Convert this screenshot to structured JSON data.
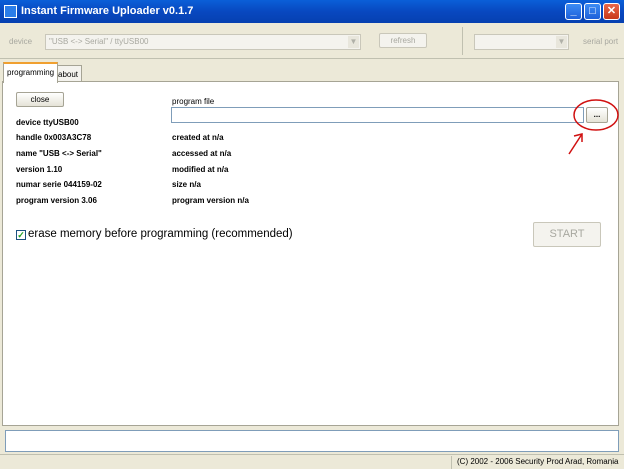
{
  "window": {
    "title": "Instant Firmware Uploader v0.1.7",
    "accent": "#0A5FD8"
  },
  "toolbar": {
    "device_label": "device",
    "device_combo_value": "\"USB <-> Serial\" / ttyUSB00",
    "refresh_label": "refresh",
    "serial_port_combo_value": "",
    "serial_port_label": "serial port"
  },
  "tabs": [
    {
      "label": "programming",
      "active": true
    },
    {
      "label": "about",
      "active": false
    }
  ],
  "device_info": {
    "close_label": "close",
    "lines": [
      "device ttyUSB00",
      "handle 0x003A3C78",
      "name \"USB <-> Serial\"",
      "version 1.10",
      "numar serie 044159-02",
      "program version 3.06"
    ]
  },
  "program_file": {
    "label": "program file",
    "value": "",
    "browse_label": "...",
    "info": [
      "created at n/a",
      "accessed at n/a",
      "modified at n/a",
      "size n/a",
      "program version n/a"
    ]
  },
  "erase": {
    "label": "erase memory before programming (recommended)",
    "checked": true
  },
  "start_label": "START",
  "annotation_color": "#D01010",
  "status_text": "",
  "footer": "(C) 2002 - 2006 Security Prod Arad, Romania"
}
